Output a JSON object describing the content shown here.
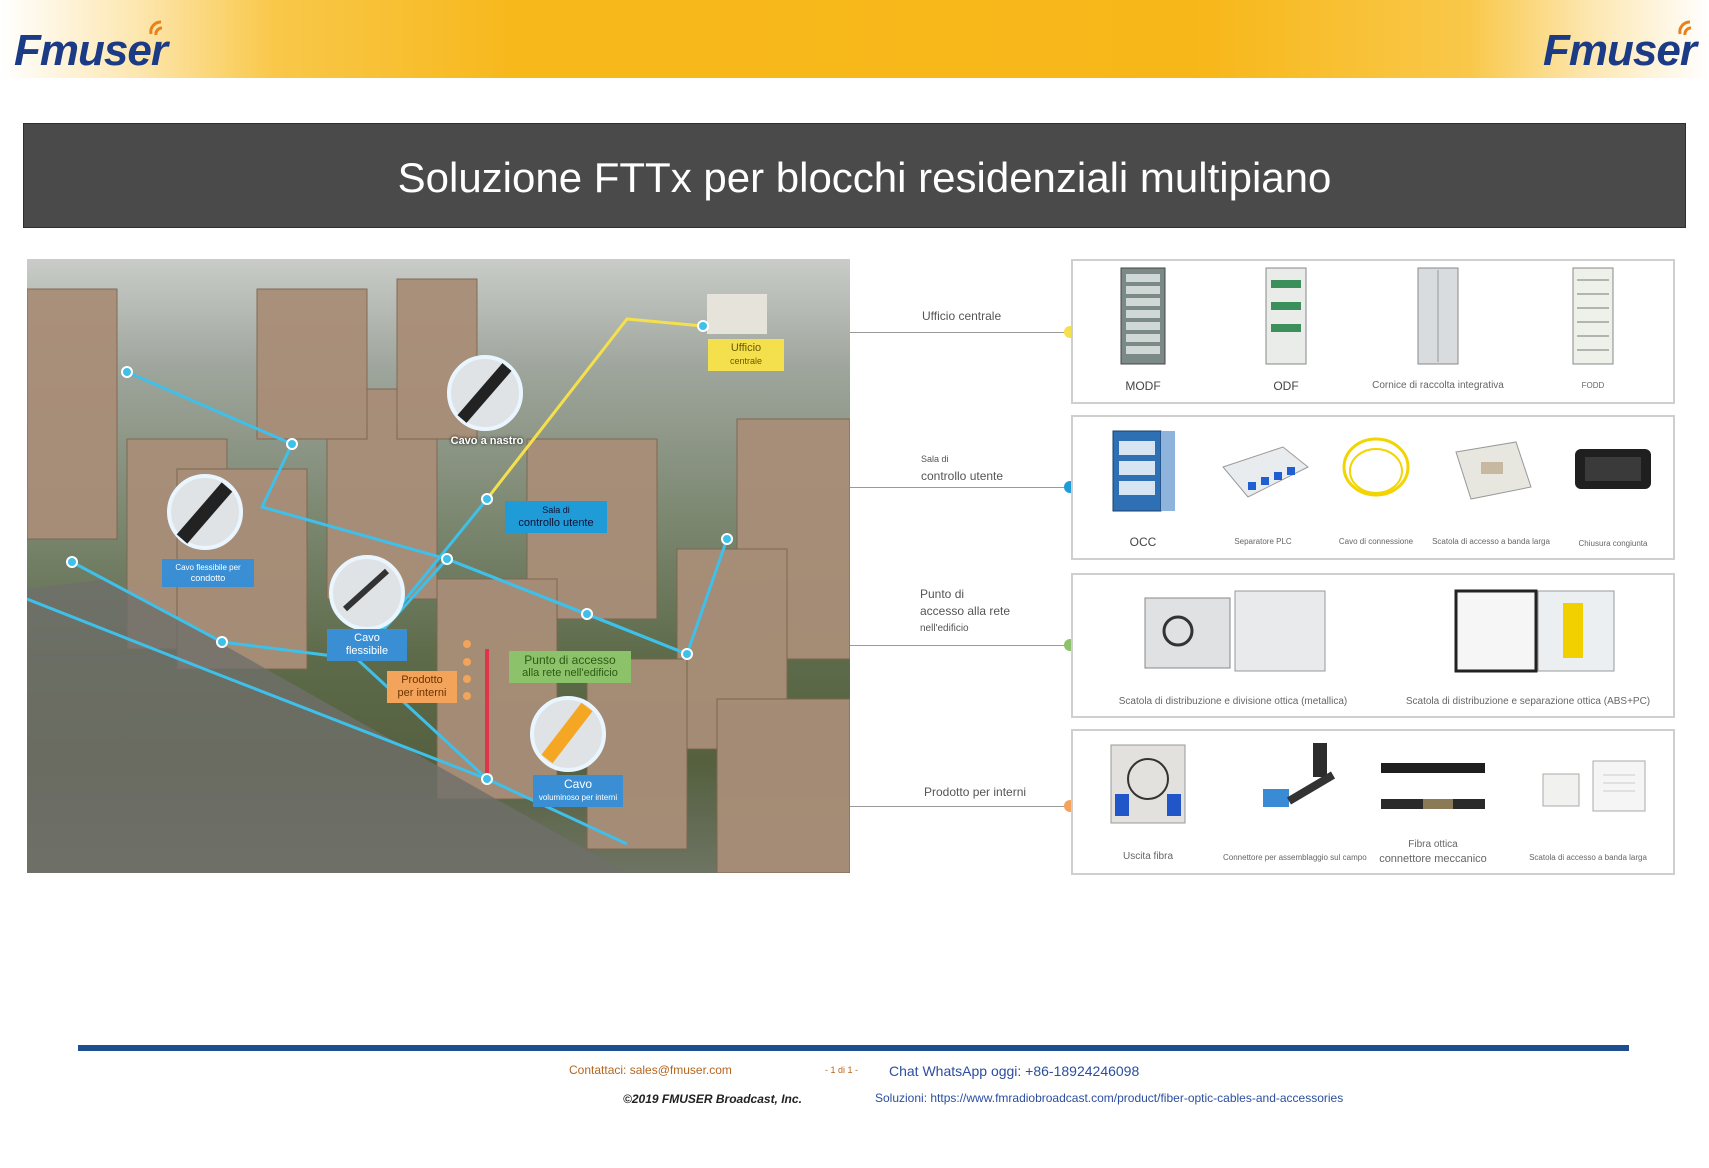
{
  "header": {
    "logo_left": "Fmuser",
    "logo_right": "Fmuser"
  },
  "title": "Soluzione FTTx per blocchi residenziali multipiano",
  "photo_labels": {
    "cavo_nastro": "Cavo a nastro",
    "ufficio": [
      "Ufficio",
      "centrale"
    ],
    "sala": [
      "Sala di",
      "controllo utente"
    ],
    "cavo_condotto": [
      "Cavo flessibile per",
      "condotto"
    ],
    "cavo_flessibile": "Cavo flessibile",
    "prodotto": [
      "Prodotto",
      "per interni"
    ],
    "punto": [
      "Punto di accesso",
      "alla rete nell'edificio"
    ],
    "cavo_vol": [
      "Cavo",
      "voluminoso per interni"
    ]
  },
  "rows": [
    {
      "label": [
        "Ufficio centrale"
      ],
      "dot_color": "#f4e04c",
      "items": [
        "MODF",
        "ODF",
        "Cornice di raccolta integrativa",
        "FODD"
      ]
    },
    {
      "label": [
        "Sala di",
        "controllo utente"
      ],
      "dot_color": "#1f9bd8",
      "items": [
        "OCC",
        "Separatore PLC",
        "Cavo di connessione",
        "Scatola di accesso a banda larga",
        "Chiusura congiunta"
      ]
    },
    {
      "label": [
        "Punto di",
        "accesso alla rete",
        "nell'edificio"
      ],
      "dot_color": "#8cc26a",
      "items": [
        "Scatola di distribuzione e divisione ottica (metallica)",
        "Scatola di distribuzione e separazione ottica (ABS+PC)"
      ]
    },
    {
      "label": [
        "Prodotto per interni"
      ],
      "dot_color": "#f4a35a",
      "items": [
        "Uscita fibra",
        "Connettore per assemblaggio sul campo",
        "Fibra ottica",
        "connettore meccanico",
        "Scatola di accesso a banda larga"
      ]
    }
  ],
  "footer": {
    "contact": "Contattaci: sales@fmuser.com",
    "page": "- 1 di 1 -",
    "whatsapp": "Chat WhatsApp oggi: +86-18924246098",
    "copyright": "©2019 FMUSER Broadcast, Inc.",
    "solutions_label": "Soluzioni:",
    "solutions_url": "https://www.fmradiobroadcast.com/product/fiber-optic-cables-and-accessories"
  },
  "colors": {
    "banner": "#f8b719",
    "logo": "#1b3b86",
    "title_bg": "#4a4a4a",
    "footer_line": "#1d4e8f",
    "contact": "#b5651d",
    "link": "#2b4ea0"
  }
}
